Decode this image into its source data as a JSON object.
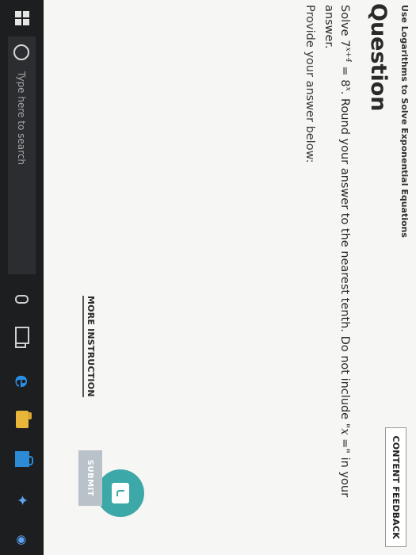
{
  "header": {
    "topic_title": "Use Logarithms to Solve Exponential Equations",
    "content_feedback_label": "CONTENT FEEDBACK"
  },
  "question": {
    "heading": "Question",
    "text_solve": "Solve ",
    "base_left": "7",
    "exp_left": "x+4",
    "equals": " = ",
    "base_right": "8",
    "exp_right": "x",
    "text_rest": ". Round your answer to the nearest tenth. Do not include \"",
    "var_x": "x",
    "text_eq": " =",
    "text_end": "\" in your answer."
  },
  "answer": {
    "prompt": "Provide your answer below:"
  },
  "actions": {
    "more_instruction_label": "MORE INSTRUCTION",
    "submit_label": "SUBMIT"
  },
  "taskbar": {
    "search_placeholder": "Type here to search"
  },
  "colors": {
    "accent_teal": "#3da8a8",
    "submit_disabled": "#b9c2c8",
    "taskbar_bg": "#1c1e20",
    "edge_blue": "#2a8fe6"
  }
}
